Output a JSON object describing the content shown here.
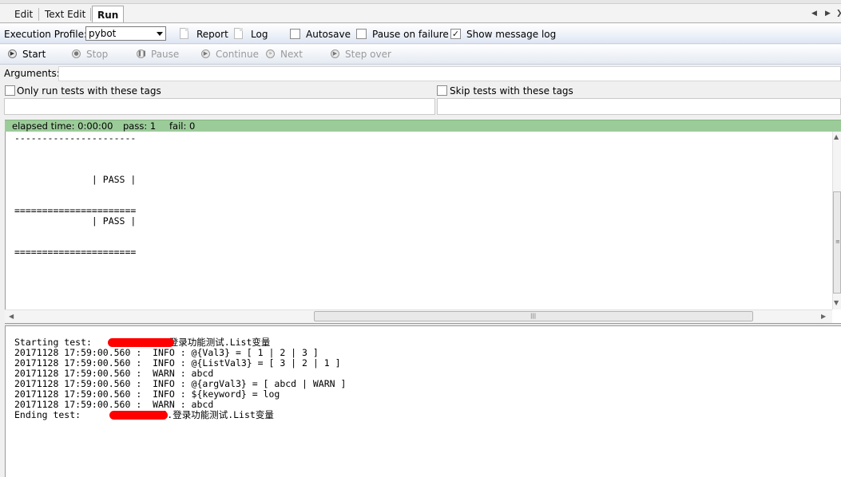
{
  "tabs": [
    {
      "label": "Edit"
    },
    {
      "label": "Text Edit"
    },
    {
      "label": "Run",
      "active": true
    }
  ],
  "profile_bar": {
    "execution_profile_label": "Execution Profile:",
    "execution_profile_value": "pybot",
    "report_label": "Report",
    "log_label": "Log",
    "autosave_label": "Autosave",
    "autosave_checked": false,
    "pause_on_failure_label": "Pause on failure",
    "pause_on_failure_checked": false,
    "show_message_log_label": "Show message log",
    "show_message_log_checked": true
  },
  "run_toolbar": {
    "start": "Start",
    "stop": "Stop",
    "pause": "Pause",
    "continue": "Continue",
    "next": "Next",
    "step_over": "Step over"
  },
  "arguments": {
    "label": "Arguments:",
    "value": ""
  },
  "tags": {
    "only_run_label": "Only run tests with these tags",
    "only_run_checked": false,
    "only_run_value": "",
    "skip_label": "Skip tests with these tags",
    "skip_checked": false,
    "skip_value": ""
  },
  "status": {
    "elapsed": "elapsed time: 0:00:00",
    "pass": "pass: 1",
    "fail": "fail: 0",
    "color": "#9ccb9a"
  },
  "console_output": {
    "lines": [
      "----------------------",
      "",
      "",
      "",
      "              | PASS |",
      "",
      "",
      "======================",
      "              | PASS |",
      "",
      "",
      "======================"
    ]
  },
  "message_log": {
    "starting_prefix": "Starting test: ",
    "starting_suffix": ".登录功能测试.List变量",
    "entries": [
      "20171128 17:59:00.560 :  INFO : @{Val3} = [ 1 | 2 | 3 ]",
      "20171128 17:59:00.560 :  INFO : @{ListVal3} = [ 3 | 2 | 1 ]",
      "20171128 17:59:00.560 :  WARN : abcd",
      "20171128 17:59:00.560 :  INFO : @{argVal3} = [ abcd | WARN ]",
      "20171128 17:59:00.560 :  INFO : ${keyword} = log",
      "20171128 17:59:00.560 :  WARN : abcd"
    ],
    "ending_prefix": "Ending test:    ",
    "ending_suffix": "目.登录功能测试.List变量"
  },
  "icons": {
    "tab_prev": "chevron-left-icon",
    "tab_next": "chevron-right-icon",
    "tab_menu": "chevron-more-icon",
    "grip": "scroll-grip-icon"
  }
}
